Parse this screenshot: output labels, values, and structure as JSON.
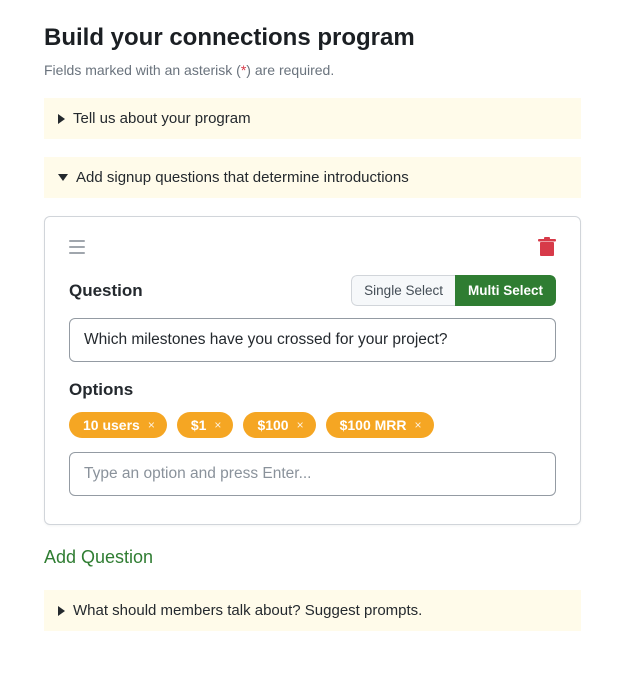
{
  "title": "Build your connections program",
  "hint_prefix": "Fields marked with an asterisk (",
  "hint_star": "*",
  "hint_suffix": ") are required.",
  "sections": {
    "about": "Tell us about your program",
    "signup": "Add signup questions that determine introductions",
    "prompts": "What should members talk about? Suggest prompts."
  },
  "question_card": {
    "question_label": "Question",
    "single_select": "Single Select",
    "multi_select": "Multi Select",
    "question_value": "Which milestones have you crossed for your project?",
    "options_label": "Options",
    "options": [
      "10 users",
      "$1",
      "$100",
      "$100 MRR"
    ],
    "option_placeholder": "Type an option and press Enter..."
  },
  "add_question": "Add Question"
}
